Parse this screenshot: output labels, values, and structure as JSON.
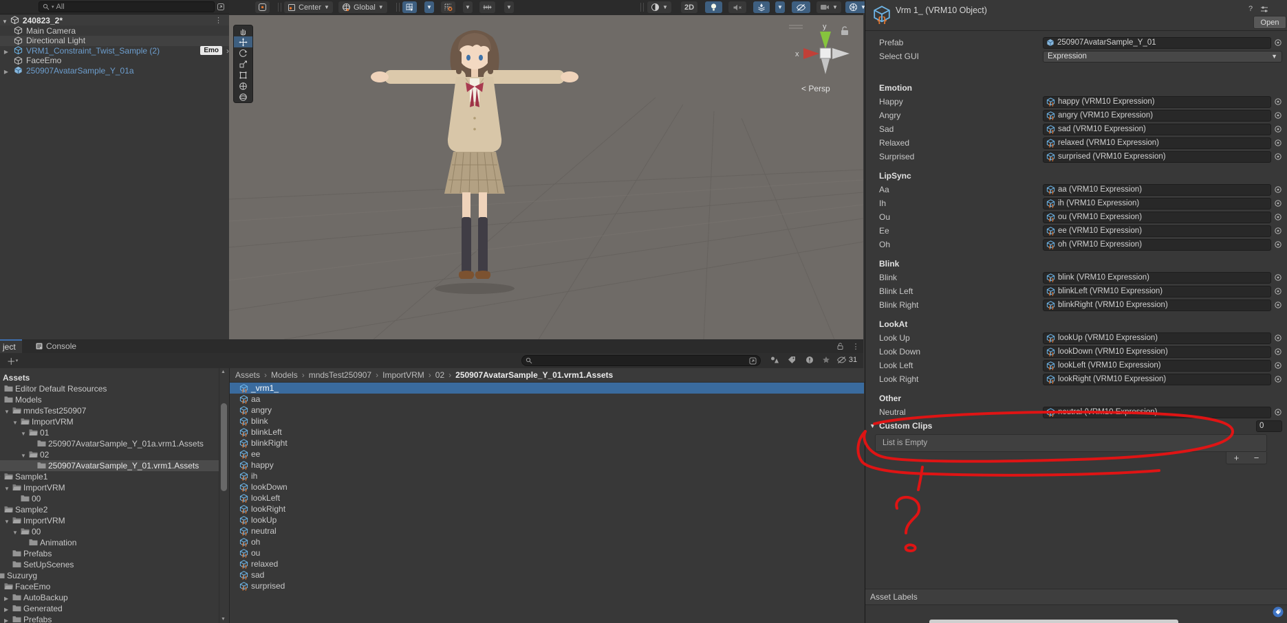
{
  "colors": {
    "selection": "#3a6b9e",
    "tool_active": "#3e5f80",
    "prefab_text": "#6d9ece",
    "annotation": "#e81313",
    "tab_accent": "#3d6fb0"
  },
  "hierarchy": {
    "search": {
      "value": "All"
    },
    "scene_row": {
      "label": "240823_2*"
    },
    "items": [
      {
        "label": "Main Camera",
        "style": "normal",
        "arrow": false
      },
      {
        "label": "Directional Light",
        "style": "normal",
        "arrow": false,
        "hover": true
      },
      {
        "label": "VRM1_Constraint_Twist_Sample (2)",
        "style": "prefab",
        "arrow": true,
        "badge": "Emo",
        "chevron": "›"
      },
      {
        "label": "FaceEmo",
        "style": "normal",
        "arrow": false
      },
      {
        "label": "250907AvatarSample_Y_01a",
        "style": "prefab_solid",
        "arrow": true
      }
    ]
  },
  "scene_toolbar": {
    "pivot": "Center",
    "orientation": "Global",
    "two_d": "2D"
  },
  "viewport": {
    "persp": "< Persp",
    "axis_x": "x",
    "axis_y": "y"
  },
  "project": {
    "tab_project": "ject",
    "tab_console": "Console",
    "visibility_count": "31",
    "breadcrumb": [
      "Assets",
      "Models",
      "mndsTest250907",
      "ImportVRM",
      "02",
      "250907AvatarSample_Y_01.vrm1.Assets"
    ],
    "tree": [
      {
        "label": "Assets",
        "level": 0,
        "arrow": "none",
        "icon": "none",
        "bold": true
      },
      {
        "label": "Editor Default Resources",
        "level": 1,
        "arrow": "none",
        "icon": "folder"
      },
      {
        "label": "Models",
        "level": 1,
        "arrow": "none",
        "icon": "folder"
      },
      {
        "label": "mndsTest250907",
        "level": 2,
        "arrow": "down",
        "icon": "folder-open"
      },
      {
        "label": "ImportVRM",
        "level": 3,
        "arrow": "down",
        "icon": "folder-open"
      },
      {
        "label": "01",
        "level": 4,
        "arrow": "down",
        "icon": "folder-open"
      },
      {
        "label": "250907AvatarSample_Y_01a.vrm1.Assets",
        "level": 5,
        "arrow": "none",
        "icon": "folder"
      },
      {
        "label": "02",
        "level": 4,
        "arrow": "down",
        "icon": "folder-open"
      },
      {
        "label": "250907AvatarSample_Y_01.vrm1.Assets",
        "level": 5,
        "arrow": "none",
        "icon": "folder",
        "selected": true
      },
      {
        "label": "Sample1",
        "level": 1,
        "arrow": "down",
        "icon": "folder-open"
      },
      {
        "label": "ImportVRM",
        "level": 2,
        "arrow": "down",
        "icon": "folder-open"
      },
      {
        "label": "00",
        "level": 3,
        "arrow": "none",
        "icon": "folder"
      },
      {
        "label": "Sample2",
        "level": 1,
        "arrow": "down",
        "icon": "folder-open"
      },
      {
        "label": "ImportVRM",
        "level": 2,
        "arrow": "down",
        "icon": "folder-open"
      },
      {
        "label": "00",
        "level": 3,
        "arrow": "down",
        "icon": "folder-open"
      },
      {
        "label": "Animation",
        "level": 4,
        "arrow": "none",
        "icon": "folder"
      },
      {
        "label": "Prefabs",
        "level": 2,
        "arrow": "none",
        "icon": "folder"
      },
      {
        "label": "SetUpScenes",
        "level": 2,
        "arrow": "none",
        "icon": "folder"
      },
      {
        "label": "Suzuryg",
        "level": 0,
        "arrow": "none",
        "icon": "folder"
      },
      {
        "label": "FaceEmo",
        "level": 1,
        "arrow": "none",
        "icon": "folder-open"
      },
      {
        "label": "AutoBackup",
        "level": 2,
        "arrow": "right",
        "icon": "folder"
      },
      {
        "label": "Generated",
        "level": 2,
        "arrow": "right",
        "icon": "folder"
      },
      {
        "label": "Prefabs",
        "level": 2,
        "arrow": "right",
        "icon": "folder"
      }
    ],
    "assets": [
      "_vrm1_",
      "aa",
      "angry",
      "blink",
      "blinkLeft",
      "blinkRight",
      "ee",
      "happy",
      "ih",
      "lookDown",
      "lookLeft",
      "lookRight",
      "lookUp",
      "neutral",
      "oh",
      "ou",
      "relaxed",
      "sad",
      "surprised"
    ],
    "selected_asset_index": 0
  },
  "inspector": {
    "title": "Vrm 1_ (VRM10 Object)",
    "open_button": "Open",
    "prefab": {
      "label": "Prefab",
      "value": "250907AvatarSample_Y_01"
    },
    "select_gui": {
      "label": "Select GUI",
      "value": "Expression"
    },
    "sections": [
      {
        "header": "Emotion",
        "rows": [
          {
            "label": "Happy",
            "value": "happy (VRM10 Expression)"
          },
          {
            "label": "Angry",
            "value": "angry (VRM10 Expression)"
          },
          {
            "label": "Sad",
            "value": "sad (VRM10 Expression)"
          },
          {
            "label": "Relaxed",
            "value": "relaxed (VRM10 Expression)"
          },
          {
            "label": "Surprised",
            "value": "surprised (VRM10 Expression)"
          }
        ]
      },
      {
        "header": "LipSync",
        "rows": [
          {
            "label": "Aa",
            "value": "aa (VRM10 Expression)"
          },
          {
            "label": "Ih",
            "value": "ih (VRM10 Expression)"
          },
          {
            "label": "Ou",
            "value": "ou (VRM10 Expression)"
          },
          {
            "label": "Ee",
            "value": "ee (VRM10 Expression)"
          },
          {
            "label": "Oh",
            "value": "oh (VRM10 Expression)"
          }
        ]
      },
      {
        "header": "Blink",
        "rows": [
          {
            "label": "Blink",
            "value": "blink (VRM10 Expression)"
          },
          {
            "label": "Blink Left",
            "value": "blinkLeft (VRM10 Expression)"
          },
          {
            "label": "Blink Right",
            "value": "blinkRight (VRM10 Expression)"
          }
        ]
      },
      {
        "header": "LookAt",
        "rows": [
          {
            "label": "Look Up",
            "value": "lookUp (VRM10 Expression)"
          },
          {
            "label": "Look Down",
            "value": "lookDown (VRM10 Expression)"
          },
          {
            "label": "Look Left",
            "value": "lookLeft (VRM10 Expression)"
          },
          {
            "label": "Look Right",
            "value": "lookRight (VRM10 Expression)"
          }
        ]
      },
      {
        "header": "Other",
        "rows": [
          {
            "label": "Neutral",
            "value": "neutral (VRM10 Expression)"
          }
        ]
      }
    ],
    "custom_clips": {
      "label": "Custom Clips",
      "size": "0",
      "empty_text": "List is Empty",
      "add": "+",
      "remove": "−"
    },
    "asset_labels": {
      "label": "Asset Labels"
    }
  }
}
